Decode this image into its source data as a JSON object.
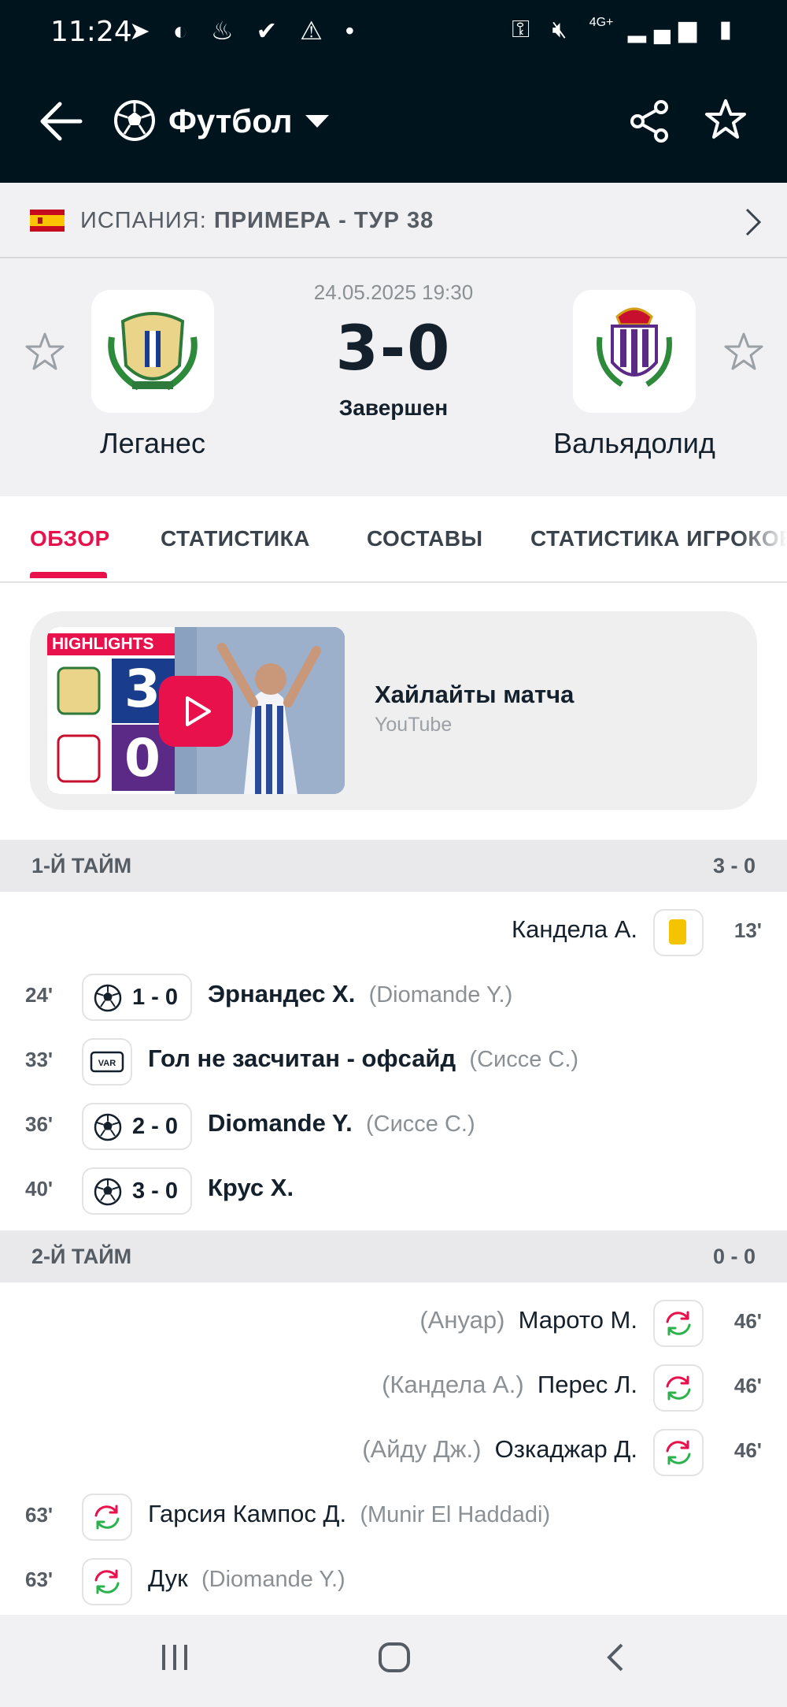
{
  "status_bar": {
    "time": "11:24",
    "net": "4G+"
  },
  "app_bar": {
    "title": "Футбол"
  },
  "league": {
    "country": "ИСПАНИЯ:",
    "competition": "ПРИМЕРА - ТУР 38"
  },
  "match": {
    "datetime": "24.05.2025 19:30",
    "score": "3-0",
    "status": "Завершен",
    "home": "Леганес",
    "away": "Вальядолид"
  },
  "tabs": [
    "ОБЗОР",
    "СТАТИСТИКА",
    "СОСТАВЫ",
    "СТАТИСТИКА ИГРОКОВ"
  ],
  "highlights": {
    "title": "Хайлайты матча",
    "source": "YouTube",
    "thumb_label": "HIGHLIGHTS",
    "thumb_home": "3",
    "thumb_away": "0"
  },
  "periods": [
    {
      "name": "1-Й ТАЙМ",
      "score": "3 - 0",
      "events": [
        {
          "minute": "13'",
          "side": "away",
          "type": "yellow-card",
          "player": "Кандела А."
        },
        {
          "minute": "24'",
          "side": "home",
          "type": "goal",
          "score": "1 - 0",
          "player": "Эрнандес Х.",
          "assist": "(Diomande Y.)"
        },
        {
          "minute": "33'",
          "side": "home",
          "type": "var",
          "player": "Гол не засчитан - офсайд",
          "assist": "(Сиссе С.)"
        },
        {
          "minute": "36'",
          "side": "home",
          "type": "goal",
          "score": "2 - 0",
          "player": "Diomande Y.",
          "assist": "(Сиссе С.)"
        },
        {
          "minute": "40'",
          "side": "home",
          "type": "goal",
          "score": "3 - 0",
          "player": "Крус Х."
        }
      ]
    },
    {
      "name": "2-Й ТАЙМ",
      "score": "0 - 0",
      "events": [
        {
          "minute": "46'",
          "side": "away",
          "type": "substitution",
          "player": "Марото М.",
          "assist": "(Ануар)"
        },
        {
          "minute": "46'",
          "side": "away",
          "type": "substitution",
          "player": "Перес Л.",
          "assist": "(Кандела А.)"
        },
        {
          "minute": "46'",
          "side": "away",
          "type": "substitution",
          "player": "Озкаджар Д.",
          "assist": "(Айду Дж.)"
        },
        {
          "minute": "63'",
          "side": "home",
          "type": "substitution",
          "player": "Гарсия Кампос Д.",
          "assist": "(Munir El Haddadi)"
        },
        {
          "minute": "63'",
          "side": "home",
          "type": "substitution",
          "player": "Дук",
          "assist": "(Diomande Y.)"
        }
      ]
    }
  ],
  "colors": {
    "accent": "#e8114c",
    "header_bg": "#00141e",
    "yellow_card": "#f5c400",
    "sub_in": "#2bb24c",
    "sub_out": "#e8114c"
  }
}
